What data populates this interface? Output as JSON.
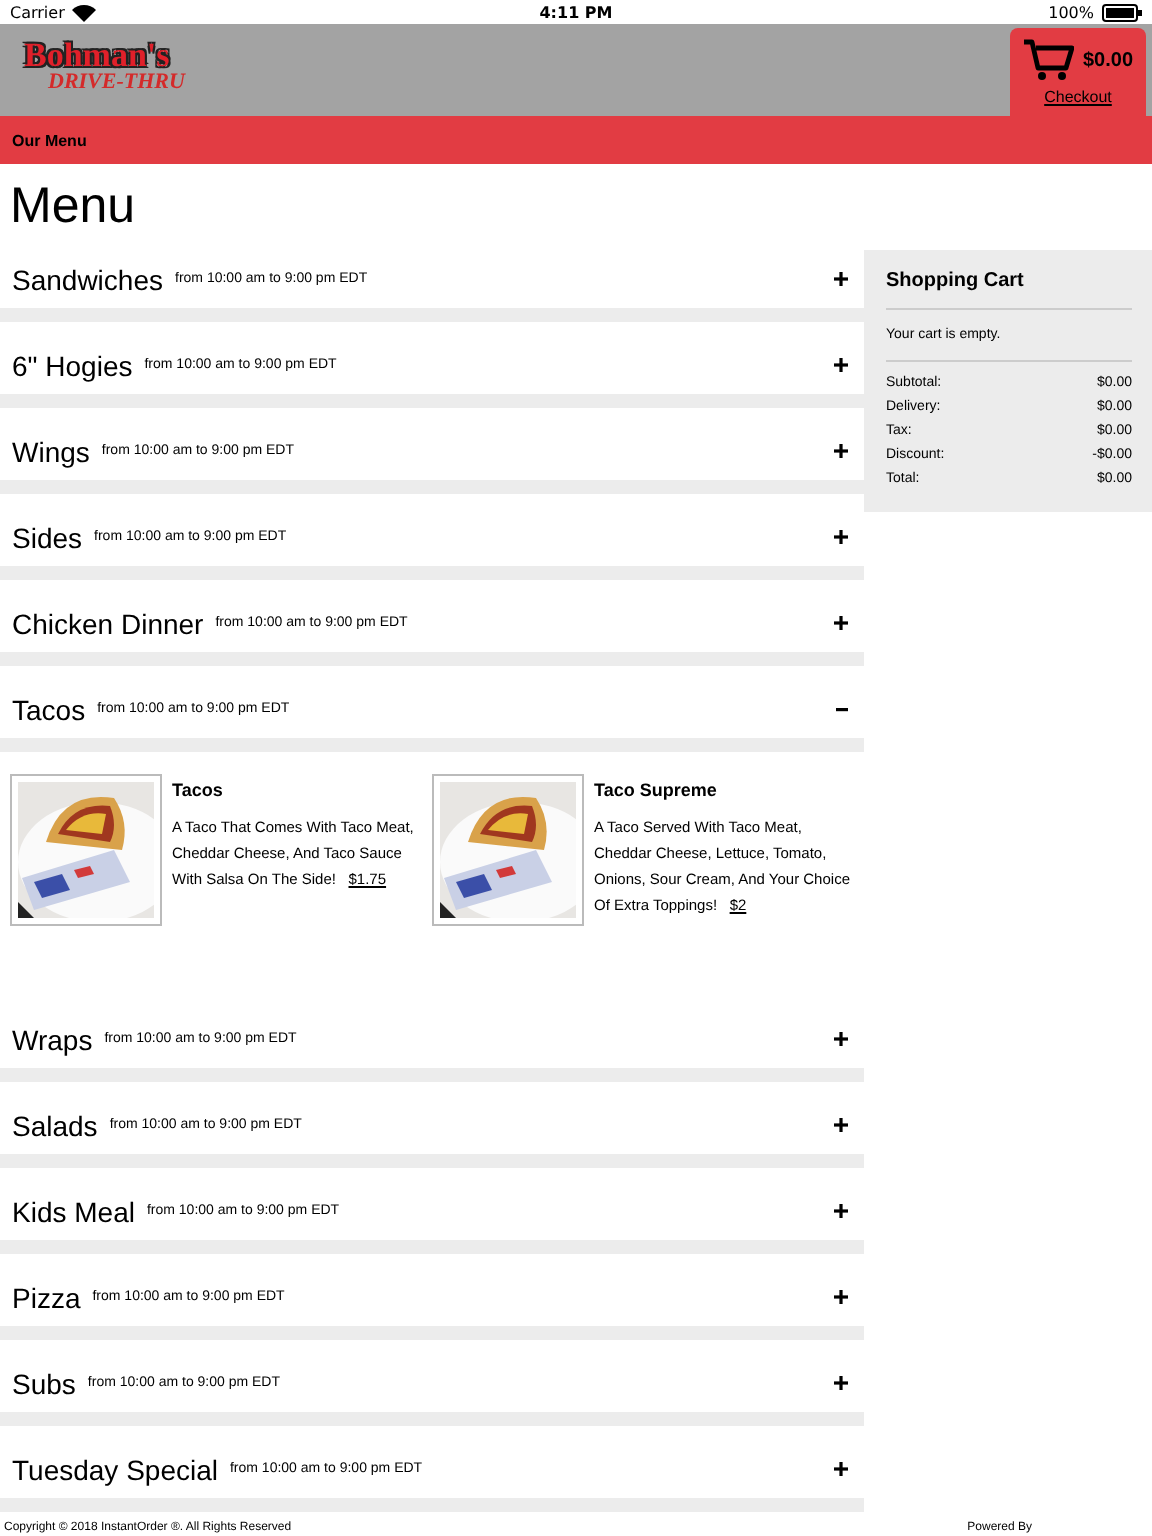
{
  "status_bar": {
    "carrier": "Carrier",
    "time": "4:11 PM",
    "battery": "100%"
  },
  "header": {
    "logo_line_1": "Bohman's",
    "logo_line_2": "DRIVE-THRU",
    "cart_total": "$0.00",
    "checkout": "Checkout"
  },
  "nav": {
    "label": "Our Menu"
  },
  "page_title": "Menu",
  "categories": [
    {
      "name": "Sandwiches",
      "hours": "from 10:00 am to 9:00 pm EDT",
      "expanded": false
    },
    {
      "name": "6\" Hogies",
      "hours": "from 10:00 am to 9:00 pm EDT",
      "expanded": false
    },
    {
      "name": "Wings",
      "hours": "from 10:00 am to 9:00 pm EDT",
      "expanded": false
    },
    {
      "name": "Sides",
      "hours": "from 10:00 am to 9:00 pm EDT",
      "expanded": false
    },
    {
      "name": "Chicken Dinner",
      "hours": "from 10:00 am to 9:00 pm EDT",
      "expanded": false
    },
    {
      "name": "Tacos",
      "hours": "from 10:00 am to 9:00 pm EDT",
      "expanded": true,
      "items": [
        {
          "name": "Tacos",
          "description": "A Taco That Comes With Taco Meat, Cheddar Cheese, And Taco Sauce With Salsa On The Side!",
          "price": "$1.75"
        },
        {
          "name": "Taco Supreme",
          "description": "A Taco Served With Taco Meat, Cheddar Cheese, Lettuce, Tomato, Onions, Sour Cream, And Your Choice Of Extra Toppings!",
          "price": "$2"
        }
      ]
    },
    {
      "name": "Wraps",
      "hours": "from 10:00 am to 9:00 pm EDT",
      "expanded": false
    },
    {
      "name": "Salads",
      "hours": "from 10:00 am to 9:00 pm EDT",
      "expanded": false
    },
    {
      "name": "Kids Meal",
      "hours": "from 10:00 am to 9:00 pm EDT",
      "expanded": false
    },
    {
      "name": "Pizza",
      "hours": "from 10:00 am to 9:00 pm EDT",
      "expanded": false
    },
    {
      "name": "Subs",
      "hours": "from 10:00 am to 9:00 pm EDT",
      "expanded": false
    },
    {
      "name": "Tuesday Special",
      "hours": "from 10:00 am to 9:00 pm EDT",
      "expanded": false
    }
  ],
  "cart": {
    "title": "Shopping Cart",
    "empty_message": "Your cart is empty.",
    "totals": [
      {
        "label": "Subtotal:",
        "value": "$0.00"
      },
      {
        "label": "Delivery:",
        "value": "$0.00"
      },
      {
        "label": "Tax:",
        "value": "$0.00"
      },
      {
        "label": "Discount:",
        "value": "-$0.00"
      },
      {
        "label": "Total:",
        "value": "$0.00"
      }
    ]
  },
  "footer": {
    "copyright": "Copyright © 2018 InstantOrder ®. All Rights Reserved",
    "powered_by": "Powered By"
  }
}
